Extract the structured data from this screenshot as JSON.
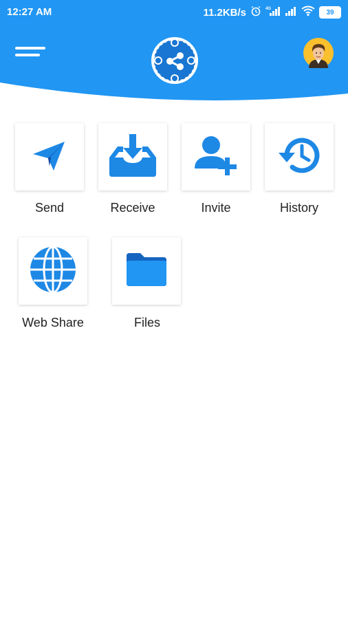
{
  "status_bar": {
    "time": "12:27 AM",
    "net_speed": "11.2KB/s",
    "battery": "39",
    "icons": [
      "alarm-icon",
      "signal-4g-icon",
      "signal-icon",
      "wifi-icon",
      "battery-icon"
    ]
  },
  "header": {
    "menu_icon": "hamburger-menu-icon",
    "logo_icon": "share-network-logo",
    "avatar_icon": "user-avatar"
  },
  "colors": {
    "primary": "#2196f3",
    "tile_icon": "#1e88e5"
  },
  "grid": {
    "items": [
      {
        "label": "Send",
        "icon": "paper-plane-icon"
      },
      {
        "label": "Receive",
        "icon": "inbox-download-icon"
      },
      {
        "label": "Invite",
        "icon": "user-add-icon"
      },
      {
        "label": "History",
        "icon": "history-clock-icon"
      },
      {
        "label": "Web Share",
        "icon": "globe-icon"
      },
      {
        "label": "Files",
        "icon": "folder-icon"
      }
    ]
  }
}
